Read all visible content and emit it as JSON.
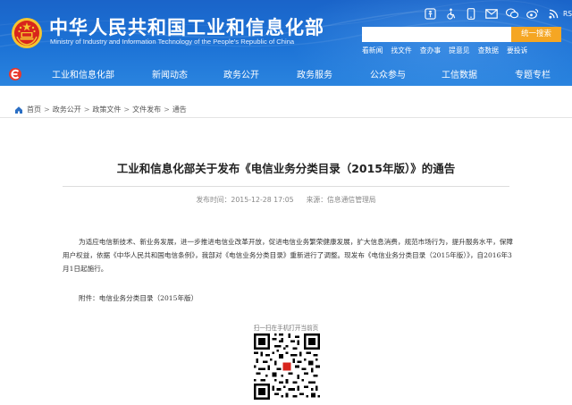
{
  "header": {
    "title": "中华人民共和国工业和信息化部",
    "subtitle": "Ministry of Industry and Information Technology of the People's Republic of China",
    "rss_label": "RSS订阅",
    "search": {
      "placeholder": "",
      "button_label": "统一搜索"
    },
    "quick_links": [
      "看新闻",
      "找文件",
      "查办事",
      "提意见",
      "查数据",
      "要投诉"
    ]
  },
  "nav": {
    "items": [
      "工业和信息化部",
      "新闻动态",
      "政务公开",
      "政务服务",
      "公众参与",
      "工信数据",
      "专题专栏"
    ]
  },
  "breadcrumb": [
    "首页",
    "政务公开",
    "政策文件",
    "文件发布",
    "通告"
  ],
  "article": {
    "title": "工业和信息化部关于发布《电信业务分类目录（2015年版）》的通告",
    "publish_label": "发布时间：",
    "publish_time": "2015-12-28 17:05",
    "source_label": "来源：",
    "source": "信息通信管理局",
    "body": "为适应电信新技术、新业务发展，进一步推进电信业改革开放，促进电信业务繁荣健康发展，扩大信息消费，规范市场行为，提升服务水平，保障用户权益，依据《中华人民共和国电信条例》，我部对《电信业务分类目录》重新进行了调整。现发布《电信业务分类目录（2015年版）》，自2016年3月1日起施行。",
    "attachment_label": "附件：",
    "attachment_name": "电信业务分类目录（2015年版）",
    "qr_caption": "扫一扫在手机打开当前页"
  },
  "colors": {
    "header_blue": "#1d73d6",
    "search_orange": "#f5a623",
    "emblem_red": "#d8241c",
    "emblem_gold": "#f4c430"
  },
  "icons": [
    "accessibility-elder-icon",
    "wheelchair-icon",
    "phone-icon",
    "mail-icon",
    "wechat-icon",
    "weibo-icon",
    "rss-icon"
  ]
}
